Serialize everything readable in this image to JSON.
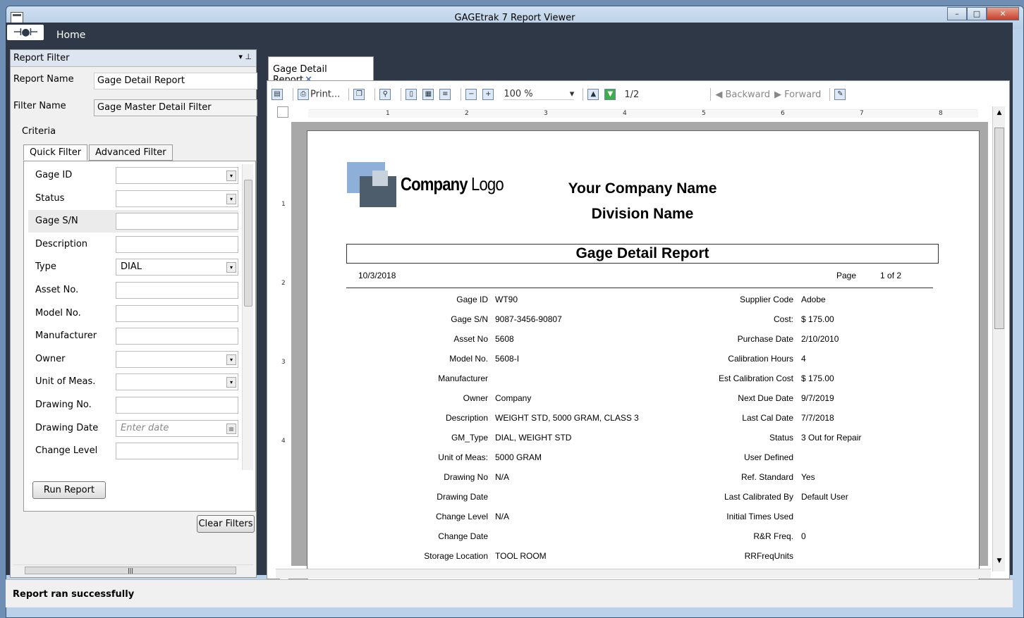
{
  "window": {
    "title": "GAGEtrak 7 Report Viewer",
    "controls": {
      "minimize": "–",
      "maximize": "□",
      "close": "✕"
    }
  },
  "menu": {
    "logo": "⊣●⊢",
    "home": "Home"
  },
  "filter_panel": {
    "header": "Report Filter",
    "header_icons": "▾  ⊥",
    "report_name_label": "Report Name",
    "report_name_value": "Gage Detail Report",
    "filter_name_label": "Filter Name",
    "filter_name_value": "Gage Master Detail Filter",
    "criteria_label": "Criteria",
    "tabs": [
      "Quick Filter",
      "Advanced Filter"
    ],
    "fields": [
      {
        "label": "Gage ID",
        "value": "",
        "kind": "dropdown"
      },
      {
        "label": "Status",
        "value": "",
        "kind": "dropdown"
      },
      {
        "label": "Gage S/N",
        "value": "",
        "kind": "text"
      },
      {
        "label": "Description",
        "value": "",
        "kind": "text"
      },
      {
        "label": "Type",
        "value": "DIAL",
        "kind": "dropdown"
      },
      {
        "label": "Asset No.",
        "value": "",
        "kind": "text"
      },
      {
        "label": "Model No.",
        "value": "",
        "kind": "text"
      },
      {
        "label": "Manufacturer",
        "value": "",
        "kind": "text"
      },
      {
        "label": "Owner",
        "value": "",
        "kind": "dropdown"
      },
      {
        "label": "Unit of Meas.",
        "value": "",
        "kind": "dropdown"
      },
      {
        "label": "Drawing No.",
        "value": "",
        "kind": "text"
      },
      {
        "label": "Drawing Date",
        "value": "",
        "placeholder": "Enter date",
        "kind": "date"
      },
      {
        "label": "Change Level",
        "value": "",
        "kind": "text"
      }
    ],
    "run_report": "Run Report",
    "clear_filters": "Clear Filters"
  },
  "doc_tab": {
    "label": "Gage Detail Report",
    "close": "✕"
  },
  "toolbar": {
    "print": "Print...",
    "zoom": "100 %",
    "page": "1/2",
    "backward": "Backward",
    "forward": "Forward"
  },
  "ruler": {
    "h_ticks": [
      "1",
      "2",
      "3",
      "4",
      "5",
      "6",
      "7",
      "8"
    ],
    "v_ticks": [
      "1",
      "2",
      "3",
      "4"
    ]
  },
  "report": {
    "logo_bold": "Company",
    "logo_light": "Logo",
    "company_name": "Your Company Name",
    "division_name": "Division Name",
    "title": "Gage Detail Report",
    "date": "10/3/2018",
    "page_label": "Page",
    "page_of": "1  of  2",
    "left_fields": [
      {
        "label": "Gage ID",
        "value": "WT90"
      },
      {
        "label": "Gage S/N",
        "value": "9087-3456-90807"
      },
      {
        "label": "Asset No",
        "value": "5608"
      },
      {
        "label": "Model No.",
        "value": "5608-I"
      },
      {
        "label": "Manufacturer",
        "value": ""
      },
      {
        "label": "Owner",
        "value": "Company"
      },
      {
        "label": "Description",
        "value": "WEIGHT STD, 5000 GRAM, CLASS 3"
      },
      {
        "label": "GM_Type",
        "value": "DIAL, WEIGHT STD"
      },
      {
        "label": "Unit of Meas:",
        "value": "5000 GRAM"
      },
      {
        "label": "Drawing No",
        "value": "N/A"
      },
      {
        "label": "Drawing Date",
        "value": ""
      },
      {
        "label": "Change Level",
        "value": "N/A"
      },
      {
        "label": "Change Date",
        "value": ""
      },
      {
        "label": "Storage Location",
        "value": "TOOL ROOM"
      }
    ],
    "right_fields": [
      {
        "label": "Supplier Code",
        "value": "Adobe"
      },
      {
        "label": "Cost:",
        "value": "$ 175.00"
      },
      {
        "label": "Purchase Date",
        "value": "2/10/2010"
      },
      {
        "label": "Calibration Hours",
        "value": "4"
      },
      {
        "label": "Est Calibration Cost",
        "value": "$ 175.00"
      },
      {
        "label": "Next Due Date",
        "value": "9/7/2019"
      },
      {
        "label": "Last Cal Date",
        "value": "7/7/2018"
      },
      {
        "label": "Status",
        "value": "3    Out for Repair"
      },
      {
        "label": "User Defined",
        "value": ""
      },
      {
        "label": "Ref. Standard",
        "value": "Yes"
      },
      {
        "label": "Last Calibrated By",
        "value": "Default User"
      },
      {
        "label": "Initial Times Used",
        "value": ""
      },
      {
        "label": "R&R Freq.",
        "value": "0"
      },
      {
        "label": "RRFreqUnits",
        "value": ""
      }
    ]
  },
  "status": {
    "message": "Report ran successfully"
  }
}
